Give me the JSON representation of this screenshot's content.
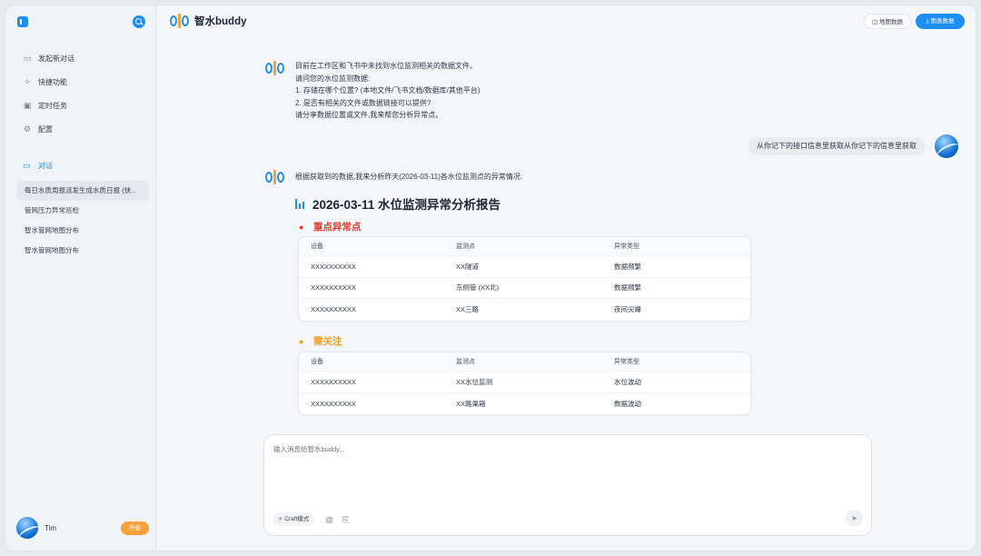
{
  "sidebar": {
    "menu": [
      {
        "label": "发起新对话",
        "icon": "chat-icon"
      },
      {
        "label": "快捷功能",
        "icon": "sparkle-icon"
      },
      {
        "label": "定时任务",
        "icon": "calendar-icon"
      },
      {
        "label": "配置",
        "icon": "gear-icon"
      }
    ],
    "conversations_label": "对话",
    "conversations": [
      "每日水质周报派发生成水质日报 (快...",
      "管网压力异常巡检",
      "智水管网地图分布",
      "智水管网地图分布"
    ],
    "user_name": "Tim",
    "upgrade_label": "升级"
  },
  "header": {
    "brand": "智水buddy",
    "map_button": "地图数据",
    "report_button": "图表数据"
  },
  "chat": {
    "bot_msg_1": [
      "目前在工作区和飞书中未找到水位监测相关的数据文件。",
      "请问您的水位监测数据:",
      "1. 存储在哪个位置? (本地文件/飞书文档/数据库/其他平台)",
      "2. 是否有相关的文件或数据链接可以提供?",
      "请分享数据位置或文件,我来帮您分析异常点。"
    ],
    "user_msg": "从你记下的接口信息里获取从你记下的信息里获取",
    "bot_msg_2": "根据获取到的数据,我来分析昨天(2026-03-11)各水位监测点的异常情况:",
    "report_title": "2026-03-11 水位监测异常分析报告",
    "section_key": {
      "title": "重点异常点",
      "headers": [
        "设备",
        "监测点",
        "异常类型"
      ],
      "rows": [
        [
          "XXXXXXXXXX",
          "XX隧道",
          "数据频繁"
        ],
        [
          "XXXXXXXXXX",
          "东侧管 (XX北)",
          "数据频繁"
        ],
        [
          "XXXXXXXXXX",
          "XX三路",
          "夜间尖峰"
        ]
      ]
    },
    "section_watch": {
      "title": "需关注",
      "headers": [
        "设备",
        "监测点",
        "异常类型"
      ],
      "rows": [
        [
          "XXXXXXXXXX",
          "XX水位监测",
          "水位波动"
        ],
        [
          "XXXXXXXXXX",
          "XX路渠箱",
          "数据波动"
        ]
      ]
    }
  },
  "composer": {
    "placeholder": "输入消息给智水buddy...",
    "craft_label": "Craft模式"
  },
  "colors": {
    "accent": "#1f8ef1",
    "orange": "#f5a13c",
    "red": "#e5392f"
  }
}
